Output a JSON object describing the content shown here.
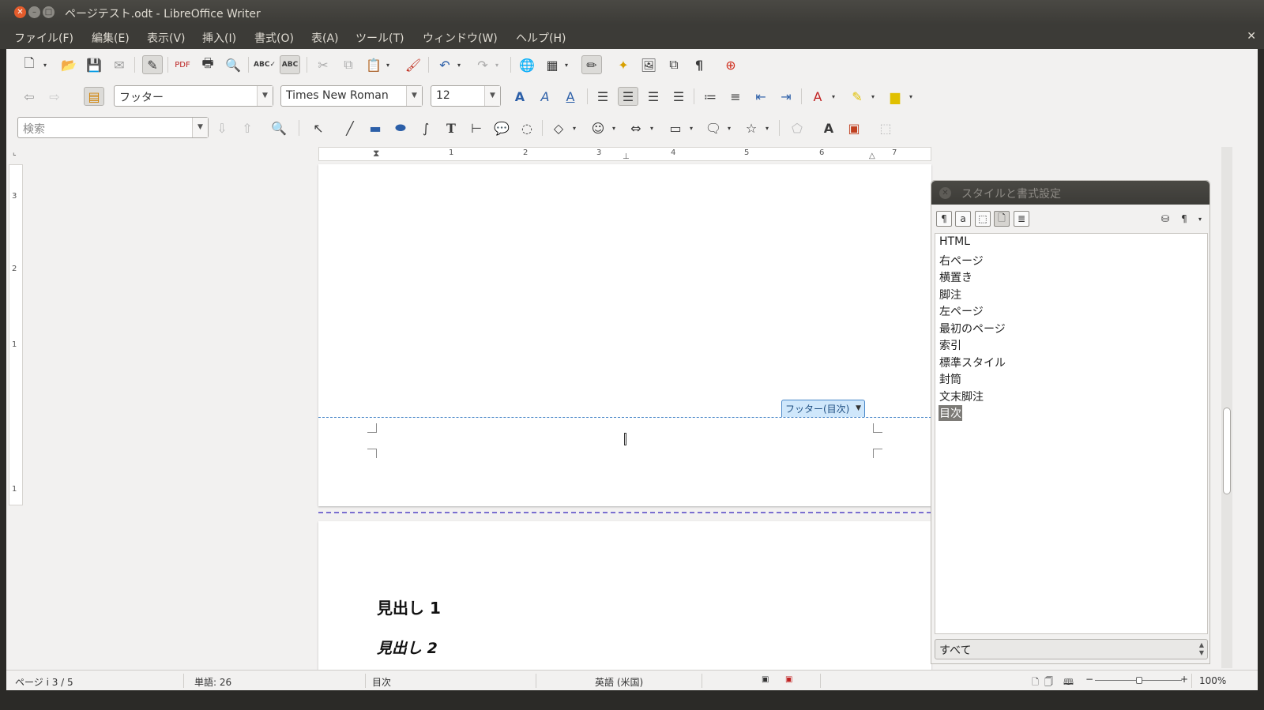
{
  "window": {
    "title": "ページテスト.odt - LibreOffice Writer"
  },
  "menubar": {
    "items": [
      "ファイル(F)",
      "編集(E)",
      "表示(V)",
      "挿入(I)",
      "書式(O)",
      "表(A)",
      "ツール(T)",
      "ウィンドウ(W)",
      "ヘルプ(H)"
    ]
  },
  "formatting": {
    "paragraph_style": "フッター",
    "font_name": "Times New Roman",
    "font_size": "12"
  },
  "find": {
    "placeholder": "検索"
  },
  "ruler": {
    "h_numbers": [
      "1",
      "2",
      "3",
      "4",
      "5",
      "6",
      "7"
    ],
    "v_numbers": [
      "3",
      "2",
      "1",
      "1"
    ]
  },
  "document": {
    "footer_label": "フッター(目次)",
    "heading1": "見出し 1",
    "heading2": "見出し 2"
  },
  "styles_panel": {
    "title": "スタイルと書式設定",
    "items": [
      "HTML",
      "右ページ",
      "横置き",
      "脚注",
      "左ページ",
      "最初のページ",
      "索引",
      "標準スタイル",
      "封筒",
      "文末脚注",
      "目次"
    ],
    "selected": "目次",
    "filter": "すべて"
  },
  "statusbar": {
    "page": "ページ i  3 / 5",
    "words": "単語: 26",
    "page_style": "目次",
    "language": "英語 (米国)",
    "zoom": "100%"
  }
}
